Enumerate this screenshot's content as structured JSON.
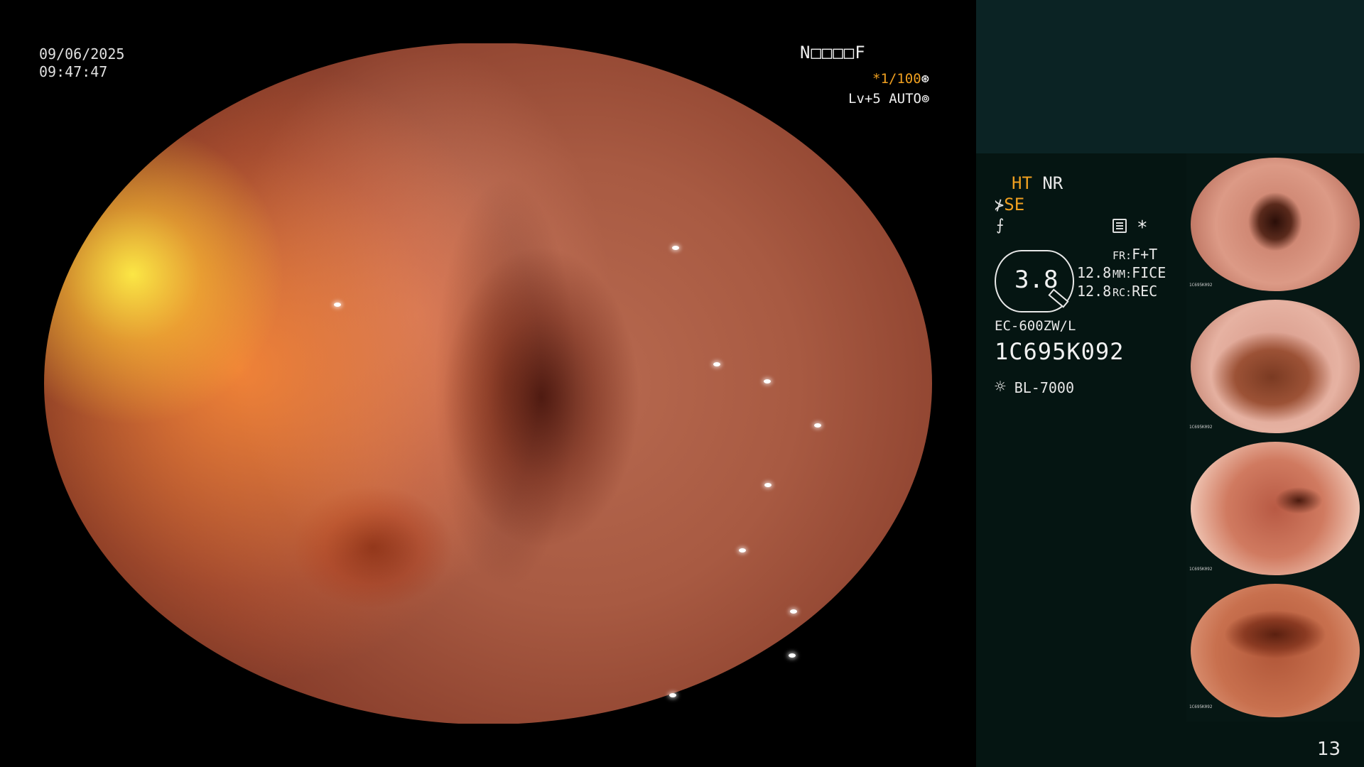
{
  "overlay": {
    "date": "09/06/2025",
    "time": "09:47:47",
    "patient_name": "N□□□□F",
    "shutter": "*1/100",
    "shutter_icon": "⊛",
    "level": "Lv+5 AUTO",
    "level_icon": "⊚"
  },
  "panel": {
    "ht_label": "HT",
    "nr_label": "NR",
    "se_symbol": "⊁",
    "se_label": "SE",
    "f_symbol": "⨍",
    "asterisk": "*",
    "zoom_value": "3.8",
    "val_1": "12.8",
    "val_2": "12.8",
    "fr_key": "FR:",
    "fr_value": "F+T",
    "mm_key": "MM:",
    "mm_value": "FICE",
    "rc_key": "RC:",
    "rc_value": "REC",
    "scope_model": "EC-600ZW/L",
    "scope_serial": "1C695K092",
    "light_icon": "☼",
    "light_source": "BL-7000"
  },
  "thumbnails": [
    {
      "caption": "1C695K092"
    },
    {
      "caption": "1C695K092"
    },
    {
      "caption": "1C695K092"
    },
    {
      "caption": "1C695K092"
    }
  ],
  "page_number": "13",
  "colors": {
    "accent_orange": "#f0a020",
    "panel_bg": "#051512",
    "panel_header": "#0b2324"
  }
}
